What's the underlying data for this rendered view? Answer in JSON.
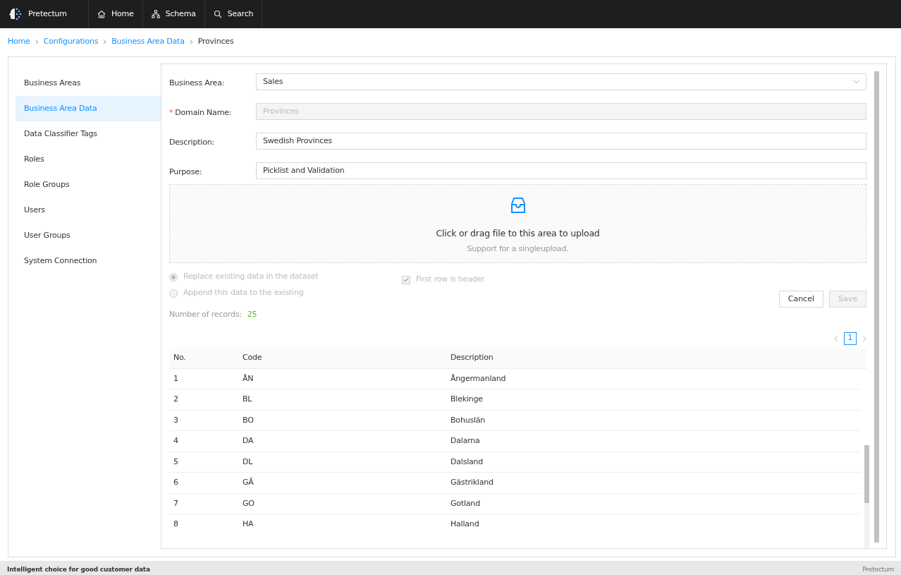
{
  "navbar": {
    "brand": "Pretectum",
    "items": [
      {
        "label": "Home",
        "kind": "home"
      },
      {
        "label": "Schema",
        "kind": "schema"
      },
      {
        "label": "Search",
        "kind": "search"
      }
    ]
  },
  "breadcrumb": [
    {
      "label": "Home",
      "current": false
    },
    {
      "label": "Configurations",
      "current": false
    },
    {
      "label": "Business Area Data",
      "current": false
    },
    {
      "label": "Provinces",
      "current": true
    }
  ],
  "sidebar": {
    "items": [
      {
        "label": "Business Areas",
        "selected": false
      },
      {
        "label": "Business Area Data",
        "selected": true
      },
      {
        "label": "Data Classifier Tags",
        "selected": false
      },
      {
        "label": "Roles",
        "selected": false
      },
      {
        "label": "Role Groups",
        "selected": false
      },
      {
        "label": "Users",
        "selected": false
      },
      {
        "label": "User Groups",
        "selected": false
      },
      {
        "label": "System Connection",
        "selected": false
      }
    ]
  },
  "form": {
    "required_mark": "*",
    "fields": [
      {
        "label": "Business Area:",
        "kind": "select",
        "required": false,
        "disabled": false,
        "value": "Sales"
      },
      {
        "label": "Domain Name:",
        "kind": "text",
        "required": true,
        "disabled": true,
        "value": "Provinces"
      },
      {
        "label": "Description:",
        "kind": "text",
        "required": false,
        "disabled": false,
        "value": "Swedish Provinces"
      },
      {
        "label": "Purpose:",
        "kind": "text",
        "required": false,
        "disabled": false,
        "value": "Picklist and Validation"
      }
    ]
  },
  "upload": {
    "title": "Click or drag file to this area to upload",
    "hint": "Support for a singleupload."
  },
  "import_options": {
    "radios": [
      {
        "label": "Replace existing data in the dataset",
        "selected": true,
        "disabled": true
      },
      {
        "label": "Append this data to the existing",
        "selected": false,
        "disabled": true
      }
    ],
    "checkbox": {
      "label": "First row is header",
      "checked": true,
      "disabled": true
    }
  },
  "buttons": [
    {
      "label": "Cancel",
      "disabled": false
    },
    {
      "label": "Save",
      "disabled": true
    }
  ],
  "records": {
    "label": "Number of records:",
    "count": "25"
  },
  "pagination": {
    "pages": [
      {
        "label": "1",
        "selected": true
      }
    ]
  },
  "table": {
    "columns": [
      "No.",
      "Code",
      "Description"
    ],
    "rows": [
      [
        "1",
        "ÅN",
        "Ångermanland"
      ],
      [
        "2",
        "BL",
        "Blekinge"
      ],
      [
        "3",
        "BO",
        "Bohuslän"
      ],
      [
        "4",
        "DA",
        "Dalarna"
      ],
      [
        "5",
        "DL",
        "Dalsland"
      ],
      [
        "6",
        "GÄ",
        "Gästrikland"
      ],
      [
        "7",
        "GO",
        "Gotland"
      ],
      [
        "8",
        "HA",
        "Halland"
      ]
    ]
  },
  "footer": {
    "tagline": "Intelligent choice for good customer data",
    "brand": "Pretectum"
  }
}
